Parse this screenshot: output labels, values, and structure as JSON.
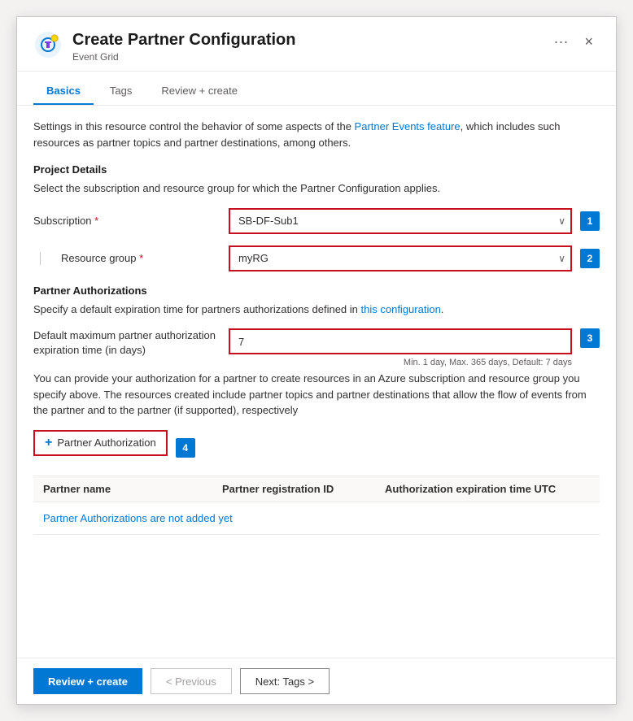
{
  "dialog": {
    "title": "Create Partner Configuration",
    "subtitle": "Event Grid",
    "close_label": "×",
    "menu_label": "···"
  },
  "tabs": [
    {
      "id": "basics",
      "label": "Basics",
      "active": true
    },
    {
      "id": "tags",
      "label": "Tags",
      "active": false
    },
    {
      "id": "review",
      "label": "Review + create",
      "active": false
    }
  ],
  "intro": {
    "text_start": "Settings in this resource control the behavior of some aspects of the ",
    "link_text": "Partner Events feature",
    "text_end": ", which includes such resources as partner topics and partner destinations, among others."
  },
  "project_details": {
    "section_title": "Project Details",
    "section_desc": "Select the subscription and resource group for which the Partner Configuration applies.",
    "subscription_label": "Subscription",
    "subscription_value": "SB-DF-Sub1",
    "subscription_badge": "1",
    "resource_group_label": "Resource group",
    "resource_group_value": "myRG",
    "resource_group_badge": "2"
  },
  "partner_authorizations": {
    "section_title": "Partner Authorizations",
    "section_desc": "Specify a default expiration time for partners authorizations defined in ",
    "section_desc_link": "this configuration",
    "section_desc_end": ".",
    "expiration_label": "Default maximum partner authorization expiration time (in days)",
    "expiration_value": "7",
    "expiration_hint": "Min. 1 day, Max. 365 days, Default: 7 days",
    "expiration_badge": "3",
    "info_text_start": "You can provide your authorization for a partner to create resources in an Azure subscription and resource group you specify above. The resources created include partner topics and partner destinations that allow the flow of events from the partner and to the partner (if supported), respectively",
    "add_button_label": "Partner Authorization",
    "add_button_badge": "4",
    "table": {
      "col_name": "Partner name",
      "col_reg_id": "Partner registration ID",
      "col_exp": "Authorization expiration time UTC",
      "empty_text": "Partner Authorizations are not added yet"
    }
  },
  "footer": {
    "review_create_label": "Review + create",
    "previous_label": "< Previous",
    "next_label": "Next: Tags >"
  },
  "icons": {
    "close": "✕",
    "menu": "···",
    "chevron_down": "⌄",
    "plus": "+"
  }
}
